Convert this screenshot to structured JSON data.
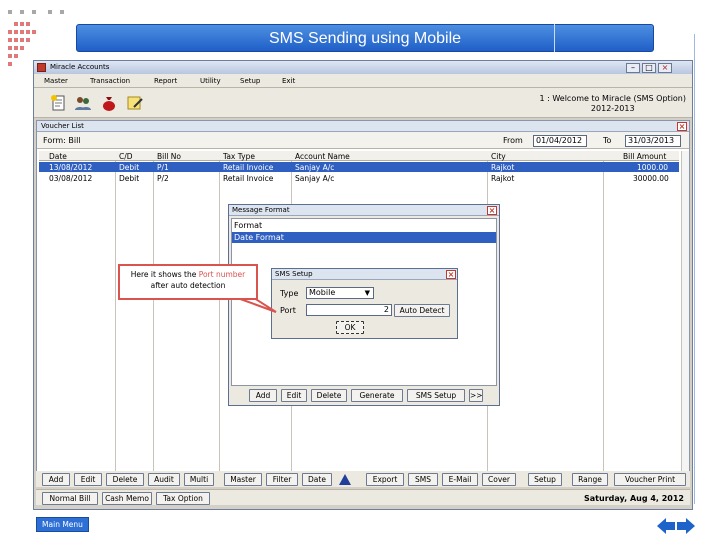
{
  "slide": {
    "title": "SMS Sending using Mobile",
    "main_menu_label": "Main Menu"
  },
  "window": {
    "title": "Miracle Accounts",
    "menu": [
      "Master",
      "Transaction",
      "Report",
      "Utility",
      "Setup",
      "Exit"
    ],
    "welcome_line1": "1 : Welcome to Miracle (SMS Option)",
    "welcome_line2": "2012-2013"
  },
  "voucher_list": {
    "title": "Voucher List",
    "form_label": "Form: Bill",
    "from_label": "From",
    "from_value": "01/04/2012",
    "to_label": "To",
    "to_value": "31/03/2013",
    "columns": [
      "Date",
      "C/D",
      "Bill No",
      "Tax Type",
      "Account Name",
      "City",
      "Bill Amount"
    ],
    "rows": [
      [
        "13/08/2012",
        "Debit",
        "P/1",
        "Retail Invoice",
        "Sanjay A/c",
        "Rajkot",
        "1000.00"
      ],
      [
        "03/08/2012",
        "Debit",
        "P/2",
        "Retail Invoice",
        "Sanjay A/c",
        "Rajkot",
        "30000.00"
      ]
    ]
  },
  "message_format": {
    "title": "Message Format",
    "items": [
      "Format",
      "Date Format"
    ],
    "buttons": [
      "Add",
      "Edit",
      "Delete",
      "Generate",
      "SMS Setup",
      ">>"
    ]
  },
  "sms_setup": {
    "title": "SMS Setup",
    "type_label": "Type",
    "type_value": "Mobile",
    "port_label": "Port",
    "port_value": "2",
    "auto_detect_label": "Auto Detect",
    "ok_label": "OK"
  },
  "callout": {
    "line1_prefix": "Here it shows the ",
    "line1_highlight": "Port number",
    "line2": "after auto detection"
  },
  "bottom_toolbar": [
    "Add",
    "Edit",
    "Delete",
    "Audit",
    "Multi",
    "Master",
    "Filter",
    "Date",
    "Export",
    "SMS",
    "E-Mail",
    "Cover",
    "Setup",
    "Range",
    "Voucher Print"
  ],
  "nav_bar": [
    "Normal Bill",
    "Cash Memo",
    "Tax Option"
  ],
  "status_date": "Saturday, Aug 4, 2012",
  "colors": {
    "accent": "#2f5fc0",
    "title_bar": "#3a7be0",
    "callout_border": "#d9534f"
  }
}
